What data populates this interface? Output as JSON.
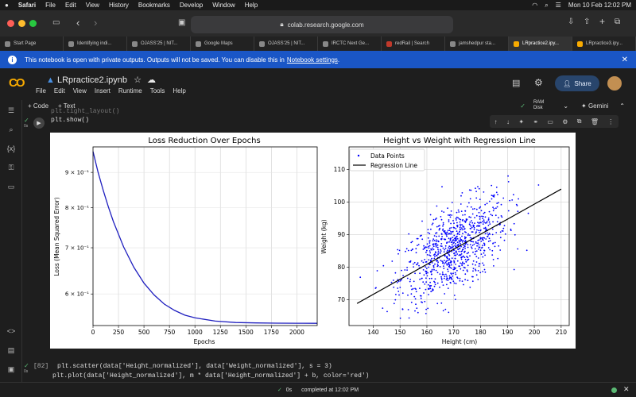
{
  "menubar": {
    "app": "Safari",
    "items": [
      "File",
      "Edit",
      "View",
      "History",
      "Bookmarks",
      "Develop",
      "Window",
      "Help"
    ],
    "datetime": "Mon 10 Feb  12:02 PM"
  },
  "browser": {
    "url": "colab.research.google.com",
    "tabs": [
      {
        "label": "Start Page",
        "active": false
      },
      {
        "label": "Identifying indi...",
        "active": false
      },
      {
        "label": "OJASS'25 | NIT...",
        "active": false
      },
      {
        "label": "Google Maps",
        "active": false
      },
      {
        "label": "OJASS'25 | NIT...",
        "active": false
      },
      {
        "label": "IRCTC Next Ge...",
        "active": false
      },
      {
        "label": "redRail | Search",
        "active": false
      },
      {
        "label": "jamshedpur sta...",
        "active": false
      },
      {
        "label": "LRpractice2.ipy...",
        "active": true
      },
      {
        "label": "LRpractice3.ipy...",
        "active": false
      }
    ]
  },
  "banner": {
    "text": "This notebook is open with private outputs. Outputs will not be saved. You can disable this in",
    "link": "Notebook settings",
    "suffix": "."
  },
  "notebook": {
    "title": "LRpractice2.ipynb",
    "menu": [
      "File",
      "Edit",
      "View",
      "Insert",
      "Runtime",
      "Tools",
      "Help"
    ],
    "share_label": "Share",
    "add_code": "+ Code",
    "add_text": "+ Text",
    "ram_label": "RAM",
    "disk_label": "Disk",
    "gemini_label": "Gemini",
    "cell_time": "0s"
  },
  "cell1": {
    "line1": "plt.tight_layout()",
    "line2": "plt.show()"
  },
  "cell2": {
    "exec_count": "[82]",
    "line1": "plt.scatter(data['Height_normalized'], data['Weight_normalized'], s = 3)",
    "line2": "plt.plot(data['Height_normalized'], m * data['Height_normalized'] + b, color='red')",
    "time": "0s"
  },
  "status": {
    "duration": "0s",
    "text": "completed at 12:02 PM"
  },
  "colors": {
    "accent_blue": "#1a56c6",
    "loss_line": "#1f1fbf",
    "scatter": "#0000ff",
    "regression": "#000000"
  },
  "chart_data": [
    {
      "type": "line",
      "title": "Loss Reduction Over Epochs",
      "xlabel": "Epochs",
      "ylabel": "Loss (Mean Squared Error)",
      "yscale": "log",
      "xlim": [
        0,
        2200
      ],
      "ylim": [
        0.54,
        0.98
      ],
      "xticks": [
        0,
        250,
        500,
        750,
        1000,
        1250,
        1500,
        1750,
        2000
      ],
      "yticks": [
        {
          "value": 0.6,
          "label": "6 × 10⁻¹"
        },
        {
          "value": 0.7,
          "label": "7 × 10⁻¹"
        },
        {
          "value": 0.8,
          "label": "8 × 10⁻¹"
        },
        {
          "value": 0.9,
          "label": "9 × 10⁻¹"
        }
      ],
      "grid": true,
      "series": [
        {
          "x": [
            0,
            50,
            100,
            150,
            200,
            300,
            400,
            500,
            600,
            700,
            800,
            900,
            1000,
            1200,
            1400,
            1600,
            1800,
            2000,
            2200
          ],
          "y": [
            0.965,
            0.9,
            0.848,
            0.803,
            0.764,
            0.702,
            0.656,
            0.622,
            0.598,
            0.58,
            0.568,
            0.559,
            0.554,
            0.548,
            0.5455,
            0.5447,
            0.5443,
            0.5441,
            0.544
          ]
        }
      ]
    },
    {
      "type": "scatter",
      "title": "Height vs Weight with Regression Line",
      "xlabel": "Height (cm)",
      "ylabel": "Weight (kg)",
      "xlim": [
        131,
        213
      ],
      "ylim": [
        62,
        117
      ],
      "xticks": [
        140,
        150,
        160,
        170,
        180,
        190,
        200,
        210
      ],
      "yticks": [
        70,
        80,
        90,
        100,
        110
      ],
      "grid": true,
      "legend_position": "top-left",
      "series": [
        {
          "name": "Data Points",
          "kind": "scatter",
          "points_shown": 900,
          "x_center": 170,
          "x_spread": 10,
          "y_center": 85,
          "y_spread": 6.5
        },
        {
          "name": "Regression Line",
          "kind": "line",
          "x": [
            134,
            210
          ],
          "y": [
            68.8,
            104
          ]
        }
      ]
    }
  ]
}
